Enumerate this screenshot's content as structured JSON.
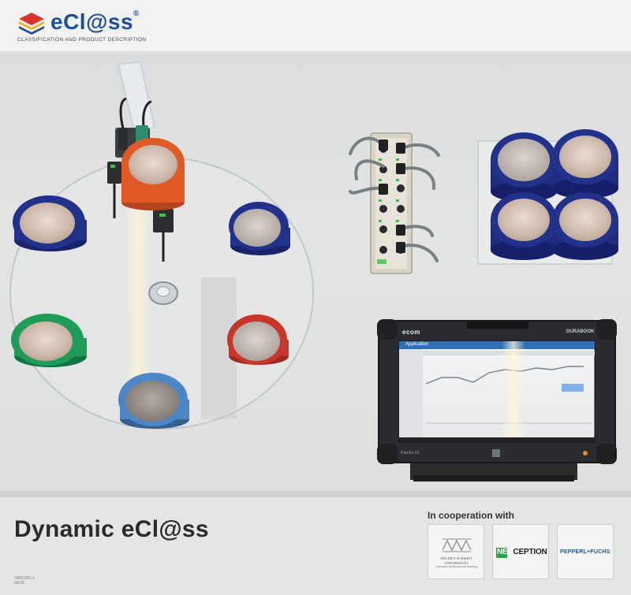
{
  "header": {
    "logo_text": "eCl@ss",
    "logo_reg": "®",
    "logo_tagline": "CLASSIFICATION AND PRODUCT DESCRIPTION"
  },
  "footer": {
    "title": "Dynamic eCl@ss",
    "code_line_1": "7A5YZ5C-1",
    "code_line_2": "05/18",
    "cooperation_label": "In cooperation with"
  },
  "partners": {
    "hsu_name": "HELMUT SCHMIDT UNIVERSITÄT",
    "hsu_sub": "Universität der Bundeswehr Hamburg",
    "nec_prefix": "NEC",
    "nec_rest": "CEPTION",
    "pf_name": "PEPPERL+FUCHS"
  },
  "tablet": {
    "brand_left": "ecom",
    "brand_right": "DURABOOK",
    "app_title": "Application",
    "model_label": "Pad-Ex 01"
  },
  "colors": {
    "logo_blue": "#1b4f9c",
    "cup_navy": "#22318a",
    "cup_orange": "#e05a25",
    "cup_green": "#1f9d58",
    "cup_red": "#c8352a",
    "cup_lightblue": "#4c86c6",
    "io_led_green": "#3ec24a",
    "nec_green": "#2aa347",
    "pf_blue": "#1d5aa6"
  }
}
